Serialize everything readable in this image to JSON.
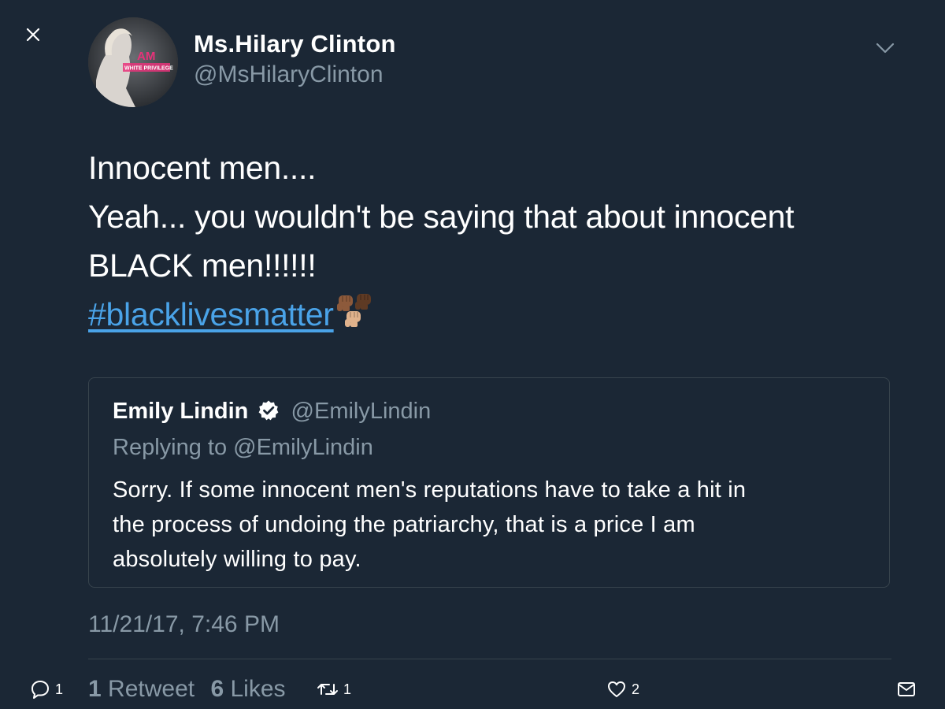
{
  "author": {
    "display_name": "Ms.Hilary Clinton",
    "handle": "@MsHilaryClinton",
    "avatar_overlay_top": "AM",
    "avatar_overlay_bottom": "WHITE PRIVILEGE"
  },
  "tweet": {
    "lines": [
      "Innocent men....",
      "Yeah... you wouldn't be saying that about innocent",
      "BLACK men!!!!!!"
    ],
    "hashtag": "#blacklivesmatter",
    "emoji_icon": "raised-fists-icon",
    "timestamp": "11/21/17, 7:46 PM"
  },
  "quoted_tweet": {
    "display_name": "Emily Lindin",
    "handle": "@EmilyLindin",
    "verified": true,
    "reply_context": "Replying to @EmilyLindin",
    "text_lines": [
      "Sorry. If some innocent men's reputations have to take a hit in",
      "the process of undoing the patriarchy, that is a price I am",
      "absolutely willing to pay."
    ]
  },
  "stats": {
    "retweet_count": "1",
    "retweet_label": "Retweet",
    "like_count": "6",
    "like_label": "Likes"
  },
  "actions": {
    "reply_count": "1",
    "retweet_count": "1",
    "like_count": "2"
  },
  "colors": {
    "background": "#1b2735",
    "link": "#4aa3e8",
    "secondary_text": "#8899a6",
    "border": "#38444d"
  }
}
